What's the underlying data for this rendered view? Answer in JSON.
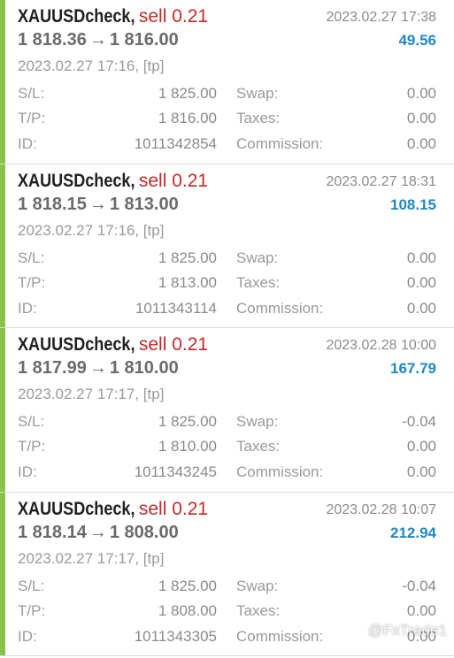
{
  "trades": [
    {
      "symbol": "XAUUSDcheck,",
      "side": "sell 0.21",
      "open_price": "1 818.36",
      "arrow": "→",
      "close_price": "1 816.00",
      "close_time": "2023.02.27 17:38",
      "profit": "49.56",
      "open_time": "2023.02.27 17:16, [tp]",
      "sl_label": "S/L:",
      "sl": "1 825.00",
      "swap_label": "Swap:",
      "swap": "0.00",
      "tp_label": "T/P:",
      "tp": "1 816.00",
      "taxes_label": "Taxes:",
      "taxes": "0.00",
      "id_label": "ID:",
      "id": "1011342854",
      "commission_label": "Commission:",
      "commission": "0.00"
    },
    {
      "symbol": "XAUUSDcheck,",
      "side": "sell 0.21",
      "open_price": "1 818.15",
      "arrow": "→",
      "close_price": "1 813.00",
      "close_time": "2023.02.27 18:31",
      "profit": "108.15",
      "open_time": "2023.02.27 17:16, [tp]",
      "sl_label": "S/L:",
      "sl": "1 825.00",
      "swap_label": "Swap:",
      "swap": "0.00",
      "tp_label": "T/P:",
      "tp": "1 813.00",
      "taxes_label": "Taxes:",
      "taxes": "0.00",
      "id_label": "ID:",
      "id": "1011343114",
      "commission_label": "Commission:",
      "commission": "0.00"
    },
    {
      "symbol": "XAUUSDcheck,",
      "side": "sell 0.21",
      "open_price": "1 817.99",
      "arrow": "→",
      "close_price": "1 810.00",
      "close_time": "2023.02.28 10:00",
      "profit": "167.79",
      "open_time": "2023.02.27 17:17, [tp]",
      "sl_label": "S/L:",
      "sl": "1 825.00",
      "swap_label": "Swap:",
      "swap": "-0.04",
      "tp_label": "T/P:",
      "tp": "1 810.00",
      "taxes_label": "Taxes:",
      "taxes": "0.00",
      "id_label": "ID:",
      "id": "1011343245",
      "commission_label": "Commission:",
      "commission": "0.00"
    },
    {
      "symbol": "XAUUSDcheck,",
      "side": "sell 0.21",
      "open_price": "1 818.14",
      "arrow": "→",
      "close_price": "1 808.00",
      "close_time": "2023.02.28 10:07",
      "profit": "212.94",
      "open_time": "2023.02.27 17:17, [tp]",
      "sl_label": "S/L:",
      "sl": "1 825.00",
      "swap_label": "Swap:",
      "swap": "-0.04",
      "tp_label": "T/P:",
      "tp": "1 808.00",
      "taxes_label": "Taxes:",
      "taxes": "0.00",
      "id_label": "ID:",
      "id": "1011343305",
      "commission_label": "Commission:",
      "commission": "0.00"
    }
  ],
  "watermark": "@FxTrade1",
  "colors": {
    "accent_bar": "#8bc34a",
    "sell": "#c62828",
    "profit": "#1e88c8"
  }
}
